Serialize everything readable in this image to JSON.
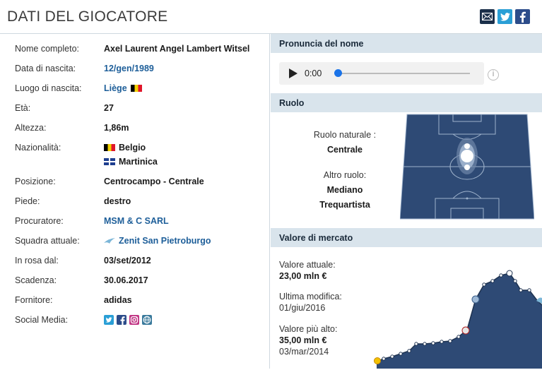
{
  "header": {
    "title": "DATI DEL GIOCATORE"
  },
  "share": {
    "icons": [
      "mail-icon",
      "twitter-icon",
      "facebook-icon"
    ],
    "colors": {
      "mail": "#1b2f4a",
      "twitter": "#2a9fd6",
      "facebook": "#2c4c8a"
    }
  },
  "player": {
    "rows": [
      {
        "label": "Nome completo:",
        "value": "Axel Laurent Angel Lambert Witsel"
      },
      {
        "label": "Data di nascita:",
        "value": "12/gen/1989"
      },
      {
        "label": "Luogo di nascita:",
        "value": "Liège"
      },
      {
        "label": "Età:",
        "value": "27"
      },
      {
        "label": "Altezza:",
        "value": "1,86m"
      },
      {
        "label": "Nazionalità:",
        "value": "Belgio",
        "value2": "Martinica"
      },
      {
        "label": "Posizione:",
        "value": "Centrocampo - Centrale"
      },
      {
        "label": "Piede:",
        "value": "destro"
      },
      {
        "label": "Procuratore:",
        "value": "MSM & C SARL"
      },
      {
        "label": "Squadra attuale:",
        "value": "Zenit San Pietroburgo"
      },
      {
        "label": "In rosa dal:",
        "value": "03/set/2012"
      },
      {
        "label": "Scadenza:",
        "value": "30.06.2017"
      },
      {
        "label": "Fornitore:",
        "value": "adidas"
      },
      {
        "label": "Social Media:",
        "value": ""
      }
    ],
    "social_icons": [
      "twitter-icon",
      "facebook-icon",
      "instagram-icon",
      "website-icon"
    ]
  },
  "pronunciation": {
    "title": "Pronuncia del nome",
    "time": "0:00"
  },
  "role": {
    "title": "Ruolo",
    "natural_label": "Ruolo naturale :",
    "natural_value": "Centrale",
    "other_label": "Altro ruolo:",
    "other_values": [
      "Mediano",
      "Trequartista"
    ],
    "pitch_color": "#2e4a75"
  },
  "market": {
    "title": "Valore di mercato",
    "current_label": "Valore attuale:",
    "current_value": "23,00 mln €",
    "modified_label": "Ultima modifica:",
    "modified_date": "01/giu/2016",
    "highest_label": "Valore più alto:",
    "highest_value": "35,00 mln €",
    "highest_date": "03/mar/2014",
    "chart_color": "#2e4a75"
  }
}
